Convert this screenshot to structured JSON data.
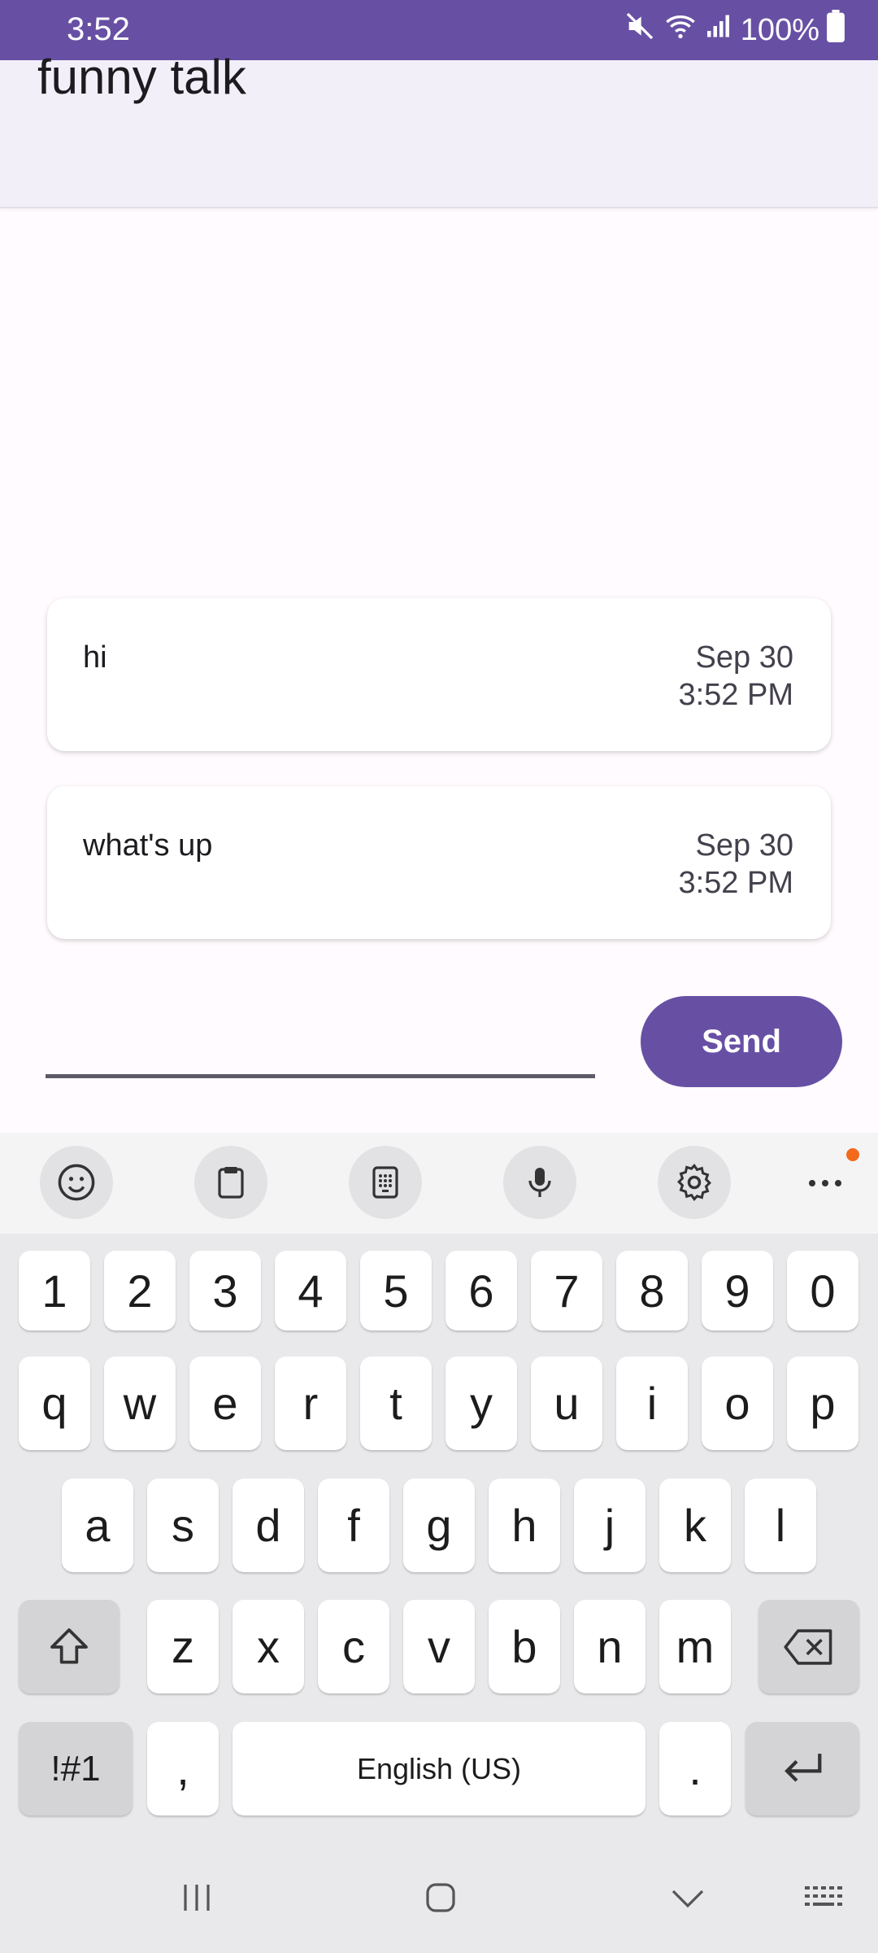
{
  "status_bar": {
    "time": "3:52",
    "battery": "100%"
  },
  "app_bar": {
    "title": "funny talk"
  },
  "messages": [
    {
      "text": "hi",
      "date": "Sep 30",
      "time": "3:52 PM"
    },
    {
      "text": "what's up",
      "date": "Sep 30",
      "time": "3:52 PM"
    }
  ],
  "composer": {
    "value": "",
    "send_label": "Send"
  },
  "keyboard": {
    "toolbar_icons": [
      "emoji-icon",
      "clipboard-icon",
      "keypad-icon",
      "microphone-icon",
      "settings-icon",
      "more-icon"
    ],
    "number_row": [
      "1",
      "2",
      "3",
      "4",
      "5",
      "6",
      "7",
      "8",
      "9",
      "0"
    ],
    "row1": [
      "q",
      "w",
      "e",
      "r",
      "t",
      "y",
      "u",
      "i",
      "o",
      "p"
    ],
    "row2": [
      "a",
      "s",
      "d",
      "f",
      "g",
      "h",
      "j",
      "k",
      "l"
    ],
    "row3": [
      "z",
      "x",
      "c",
      "v",
      "b",
      "n",
      "m"
    ],
    "symbols_label": "!#1",
    "comma_label": ",",
    "space_label": "English (US)",
    "period_label": "."
  },
  "colors": {
    "primary": "#6750a4",
    "notification_dot": "#f26b1d"
  }
}
